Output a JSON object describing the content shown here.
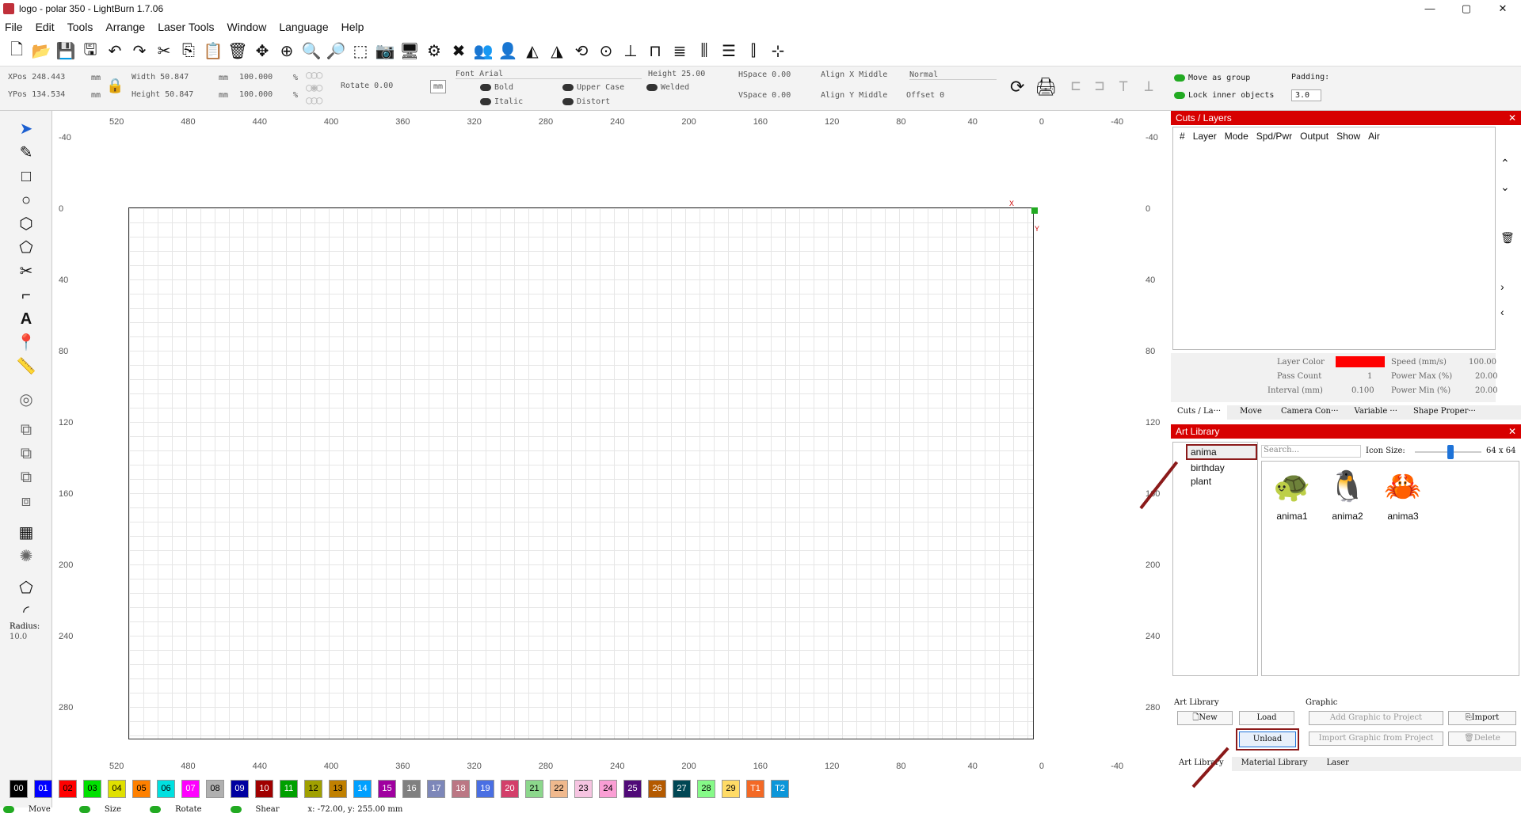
{
  "window": {
    "title": "logo - polar 350 - LightBurn 1.7.06",
    "min": "—",
    "max": "▢",
    "close": "✕"
  },
  "menu": [
    "File",
    "Edit",
    "Tools",
    "Arrange",
    "Laser Tools",
    "Window",
    "Language",
    "Help"
  ],
  "toolbar_icons": [
    "new-file-icon",
    "open-file-icon",
    "save-icon",
    "save-as-icon",
    "undo-icon",
    "redo-icon",
    "cut-icon",
    "copy-icon",
    "paste-icon",
    "delete-icon",
    "move-icon",
    "zoom-fit-icon",
    "zoom-in-icon",
    "zoom-out-icon",
    "select-frame-icon",
    "camera-icon",
    "monitor-icon",
    "settings-icon",
    "tools-icon",
    "group-icon",
    "user-icon",
    "mirror-h-icon",
    "mirror-v-icon",
    "rotate-icon",
    "target-icon",
    "align-center-icon",
    "distribute-icon",
    "dock-icon",
    "align-icon",
    "spread-icon",
    "push-icon",
    "grid-snap-icon"
  ],
  "props": {
    "xpos": "XPos 248.443",
    "ypos": "YPos 134.534",
    "unit": "mm",
    "width": "Width 50.847",
    "height": "Height 50.847",
    "wpct": "100.000",
    "hpct": "100.000",
    "pct": "%",
    "rotate": "Rotate 0.00",
    "mm_btn": "mm",
    "font": "Font Arial",
    "font_height": "Height 25.00",
    "hspace": "HSpace 0.00",
    "vspace": "VSpace 0.00",
    "align_x": "Align X Middle",
    "align_y": "Align Y Middle",
    "normal": "Normal",
    "offset": "Offset 0",
    "bold": "Bold",
    "italic": "Italic",
    "upper": "Upper Case",
    "distort": "Distort",
    "welded": "Welded",
    "move_group": "Move as group",
    "lock_inner": "Lock inner objects",
    "padding": "Padding:",
    "padding_val": "3.0"
  },
  "left_tools": {
    "radius_label": "Radius:",
    "radius_val": "10.0"
  },
  "ruler": {
    "top": [
      "520",
      "480",
      "440",
      "400",
      "360",
      "320",
      "280",
      "240",
      "200",
      "160",
      "120",
      "80",
      "40",
      "0",
      "-40"
    ],
    "side": [
      "-40",
      "0",
      "40",
      "80",
      "120",
      "160",
      "200",
      "240",
      "280"
    ],
    "axis_x": "X",
    "axis_y": "Y"
  },
  "layers": {
    "title": "Cuts / Layers",
    "cols": [
      "#",
      "Layer",
      "Mode",
      "Spd/Pwr",
      "Output",
      "Show",
      "Air"
    ],
    "layer_color": "Layer Color",
    "speed": "Speed (mm/s)",
    "speed_val": "100.00",
    "pass_count": "Pass Count",
    "pass_val": "1",
    "power_max": "Power Max (%)",
    "pmax_val": "20.00",
    "interval": "Interval (mm)",
    "interval_val": "0.100",
    "power_min": "Power Min (%)",
    "pmin_val": "20.00",
    "tabs": [
      "Cuts / La···",
      "Move",
      "Camera Con···",
      "Variable ···",
      "Shape Proper···"
    ],
    "red": "#ff0000"
  },
  "art": {
    "title": "Art Library",
    "libraries": [
      "anima",
      "birthday",
      "plant"
    ],
    "search_ph": "Search...",
    "icon_size": "Icon Size:",
    "icon_size_val": "64 x 64",
    "items": [
      "anima1",
      "anima2",
      "anima3"
    ],
    "lib_group": "Art Library",
    "graphic_group": "Graphic",
    "new": "New",
    "load": "Load",
    "unload": "Unload",
    "add_graphic": "Add Graphic to Project",
    "import": "Import",
    "import_graphic": "Import Graphic from Project",
    "delete": "Delete",
    "tabs": [
      "Art Library",
      "Material Library",
      "Laser"
    ]
  },
  "palette": [
    {
      "l": "00",
      "c": "#000000",
      "t": "#fff"
    },
    {
      "l": "01",
      "c": "#0000ff",
      "t": "#fff"
    },
    {
      "l": "02",
      "c": "#ff0000",
      "t": "#000"
    },
    {
      "l": "03",
      "c": "#00e000",
      "t": "#000"
    },
    {
      "l": "04",
      "c": "#e0e000",
      "t": "#000"
    },
    {
      "l": "05",
      "c": "#ff8000",
      "t": "#000"
    },
    {
      "l": "06",
      "c": "#00e0e0",
      "t": "#000"
    },
    {
      "l": "07",
      "c": "#ff00ff",
      "t": "#fff"
    },
    {
      "l": "08",
      "c": "#b0b0b0",
      "t": "#000"
    },
    {
      "l": "09",
      "c": "#0000a0",
      "t": "#fff"
    },
    {
      "l": "10",
      "c": "#a00000",
      "t": "#fff"
    },
    {
      "l": "11",
      "c": "#00a000",
      "t": "#fff"
    },
    {
      "l": "12",
      "c": "#a0a000",
      "t": "#000"
    },
    {
      "l": "13",
      "c": "#c08000",
      "t": "#000"
    },
    {
      "l": "14",
      "c": "#00a0ff",
      "t": "#fff"
    },
    {
      "l": "15",
      "c": "#a000a0",
      "t": "#fff"
    },
    {
      "l": "16",
      "c": "#808080",
      "t": "#fff"
    },
    {
      "l": "17",
      "c": "#7d87b9",
      "t": "#fff"
    },
    {
      "l": "18",
      "c": "#bb7784",
      "t": "#fff"
    },
    {
      "l": "19",
      "c": "#4a6fe3",
      "t": "#fff"
    },
    {
      "l": "20",
      "c": "#d33f6a",
      "t": "#fff"
    },
    {
      "l": "21",
      "c": "#8cd78c",
      "t": "#000"
    },
    {
      "l": "22",
      "c": "#f0b98d",
      "t": "#000"
    },
    {
      "l": "23",
      "c": "#f6c4e1",
      "t": "#000"
    },
    {
      "l": "24",
      "c": "#fa9ed4",
      "t": "#000"
    },
    {
      "l": "25",
      "c": "#500a78",
      "t": "#fff"
    },
    {
      "l": "26",
      "c": "#b45a00",
      "t": "#fff"
    },
    {
      "l": "27",
      "c": "#004754",
      "t": "#fff"
    },
    {
      "l": "28",
      "c": "#86fa88",
      "t": "#000"
    },
    {
      "l": "29",
      "c": "#ffdb66",
      "t": "#000"
    },
    {
      "l": "T1",
      "c": "#f36926",
      "t": "#fff"
    },
    {
      "l": "T2",
      "c": "#0c96d9",
      "t": "#fff"
    }
  ],
  "status": {
    "move": "Move",
    "size": "Size",
    "rotate": "Rotate",
    "shear": "Shear",
    "coords": "x: -72.00, y: 255.00 mm"
  }
}
